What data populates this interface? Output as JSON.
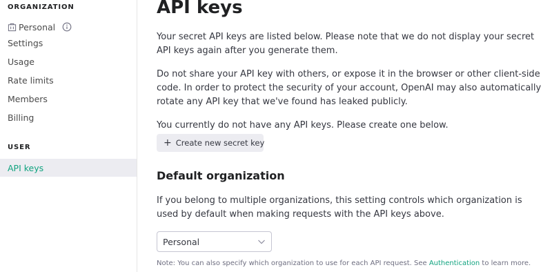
{
  "sidebar": {
    "organization_heading": "ORGANIZATION",
    "org_name": "Personal",
    "org_items": [
      "Settings",
      "Usage",
      "Rate limits",
      "Members",
      "Billing"
    ],
    "user_heading": "USER",
    "user_items": [
      "API keys"
    ],
    "active_item": "API keys",
    "icons": {
      "org": "building-icon",
      "info": "info-icon"
    }
  },
  "main": {
    "title": "API keys",
    "intro": "Your secret API keys are listed below. Please note that we do not display your secret API keys again after you generate them.",
    "warning": "Do not share your API key with others, or expose it in the browser or other client-side code. In order to protect the security of your account, OpenAI may also automatically rotate any API key that we've found has leaked publicly.",
    "empty_state": "You currently do not have any API keys. Please create one below.",
    "create_button": "Create new secret key",
    "default_org": {
      "title": "Default organization",
      "description": "If you belong to multiple organizations, this setting controls which organization is used by default when making requests with the API keys above.",
      "selected": "Personal",
      "note_prefix": "Note: You can also specify which organization to use for each API request. See ",
      "note_link": "Authentication",
      "note_suffix": " to learn more."
    }
  },
  "colors": {
    "accent": "#10a37f",
    "active_bg": "#ececf1",
    "text": "#353740"
  }
}
